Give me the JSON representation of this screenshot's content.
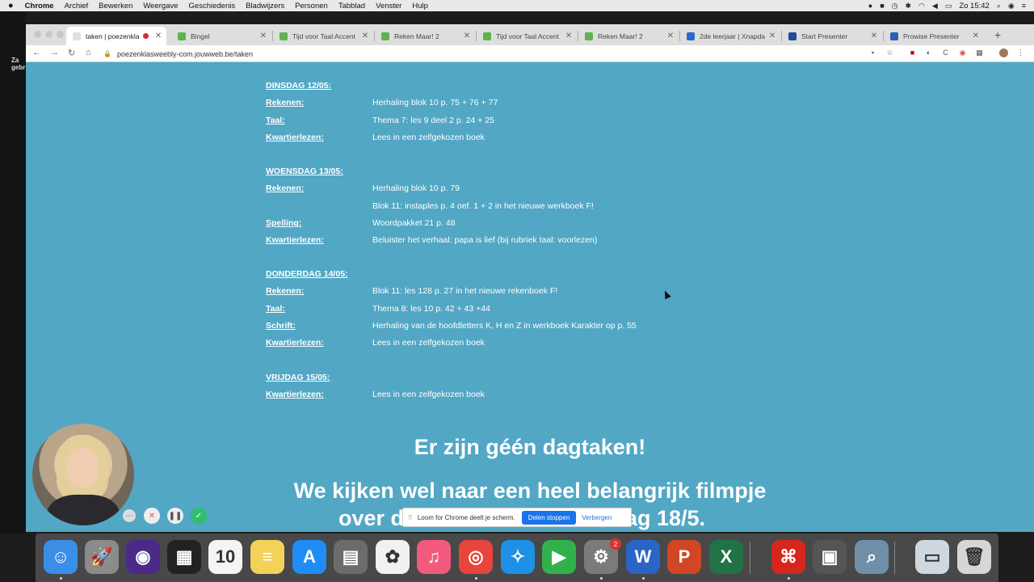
{
  "menubar": {
    "items": [
      "Chrome",
      "Archief",
      "Bewerken",
      "Weergave",
      "Geschiedenis",
      "Bladwijzers",
      "Personen",
      "Tabblad",
      "Venster",
      "Hulp"
    ],
    "clock": "Zo 15:42"
  },
  "desktop": {
    "label_line1": "Za",
    "label_line2": "gebr"
  },
  "browser": {
    "tabs": [
      {
        "title": "taken | poezenkla",
        "favicon_color": "#e0e0e0",
        "active": true,
        "recording": true
      },
      {
        "title": "Bingel",
        "favicon_color": "#5fb24f"
      },
      {
        "title": "Tijd voor Taal Accent",
        "favicon_color": "#5fb24f"
      },
      {
        "title": "Reken Maar! 2",
        "favicon_color": "#5fb24f"
      },
      {
        "title": "Tijd voor Taal Accent",
        "favicon_color": "#5fb24f"
      },
      {
        "title": "Reken Maar! 2",
        "favicon_color": "#5fb24f"
      },
      {
        "title": "2de leerjaar | Xnapda",
        "favicon_color": "#2a6bc9"
      },
      {
        "title": "Start Presenter",
        "favicon_color": "#1d4e9e"
      },
      {
        "title": "Prowise Presenter",
        "favicon_color": "#2d5fb3"
      }
    ],
    "url": "poezenklasweebly-com.jouwweb.be/taken"
  },
  "schedule": {
    "days": [
      {
        "day": "DINSDAG 12/05:",
        "entries": [
          {
            "subject": "Rekenen:",
            "text": "Herhaling blok 10 p. 75 + 76 + 77"
          },
          {
            "subject": "Taal:",
            "text": "Thema 7: les 9 deel 2 p. 24 + 25"
          },
          {
            "subject": "Kwartierlezen:",
            "text": "Lees in een zelfgekozen boek"
          }
        ]
      },
      {
        "day": "WOENSDAG 13/05:",
        "entries": [
          {
            "subject": "Rekenen:",
            "text": "Herhaling blok 10 p. 79"
          },
          {
            "subject": "",
            "text": "Blok 11: instaples p. 4 oef. 1 + 2 in het nieuwe werkboek F!"
          },
          {
            "subject": "Spelling:",
            "text": "Woordpakket 21 p. 48"
          },
          {
            "subject": "Kwartierlezen:",
            "text": "Beluister het verhaal: papa is lief (bij rubriek taal: voorlezen)"
          }
        ]
      },
      {
        "day": "DONDERDAG 14/05:",
        "entries": [
          {
            "subject": "Rekenen:",
            "text": "Blok 11: les 128 p. 27 in het nieuwe rekenboek F!"
          },
          {
            "subject": "Taal:",
            "text": "Thema 8: les 10 p. 42 + 43 +44"
          },
          {
            "subject": "Schrift:",
            "text": "Herhaling van de hoofdletters K, H en Z in werkboek Karakter op p. 55"
          },
          {
            "subject": "Kwartierlezen:",
            "text": "Lees in een zelfgekozen boek"
          }
        ]
      },
      {
        "day": "VRIJDAG 15/05:",
        "entries": [
          {
            "subject": "Kwartierlezen:",
            "text": "Lees in een zelfgekozen boek"
          }
        ]
      }
    ]
  },
  "headline": "Er zijn géén dagtaken!",
  "subline_left": "We kijken wel naar een heel belangrijk filmpje",
  "subline_bottom_left": "over d",
  "subline_bottom_right": "ag 18/5.",
  "loom": {
    "message": "Loom for Chrome deelt je scherm.",
    "stop_label": "Delen stoppen",
    "hide_label": "Verbergen"
  },
  "dock": {
    "apps": [
      {
        "name": "Finder",
        "glyph": "☺",
        "color": "#3b8ee8"
      },
      {
        "name": "Launchpad",
        "glyph": "🚀",
        "color": "#8b8b8b"
      },
      {
        "name": "Siri",
        "glyph": "◉",
        "color": "#4b2a88"
      },
      {
        "name": "Photo Booth",
        "glyph": "▦",
        "color": "#222222"
      },
      {
        "name": "Agenda",
        "glyph": "10",
        "color": "#f4f4f4",
        "label": "MEI"
      },
      {
        "name": "Notities",
        "glyph": "≡",
        "color": "#f3d25a"
      },
      {
        "name": "App Store",
        "glyph": "A",
        "color": "#1f8df5"
      },
      {
        "name": "Rekenmachine",
        "glyph": "▤",
        "color": "#6c6c6c"
      },
      {
        "name": "Foto's",
        "glyph": "✿",
        "color": "#f1f1f1"
      },
      {
        "name": "Muziek",
        "glyph": "♫",
        "color": "#f15a7c"
      },
      {
        "name": "Chrome",
        "glyph": "◎",
        "color": "#e8453c"
      },
      {
        "name": "Safari",
        "glyph": "✧",
        "color": "#1e90e6"
      },
      {
        "name": "FaceTime",
        "glyph": "▶",
        "color": "#30b14c"
      },
      {
        "name": "Systeemvoorkeuren",
        "glyph": "⚙",
        "color": "#7b7b7b",
        "badge": "2"
      },
      {
        "name": "Word",
        "glyph": "W",
        "color": "#2a64c5"
      },
      {
        "name": "PowerPoint",
        "glyph": "P",
        "color": "#d24625"
      },
      {
        "name": "Excel",
        "glyph": "X",
        "color": "#217346"
      },
      {
        "name": "Acrobat",
        "glyph": "⌘",
        "color": "#d7261d"
      },
      {
        "name": "Beeldscherm",
        "glyph": "▣",
        "color": "#555555"
      },
      {
        "name": "Voorvertoning",
        "glyph": "⌕",
        "color": "#6f8fa8"
      },
      {
        "name": "Bureaublad",
        "glyph": "▭",
        "color": "#cfd8df"
      },
      {
        "name": "Prullenmand",
        "glyph": "🗑",
        "color": "#d6d6d6"
      }
    ]
  }
}
